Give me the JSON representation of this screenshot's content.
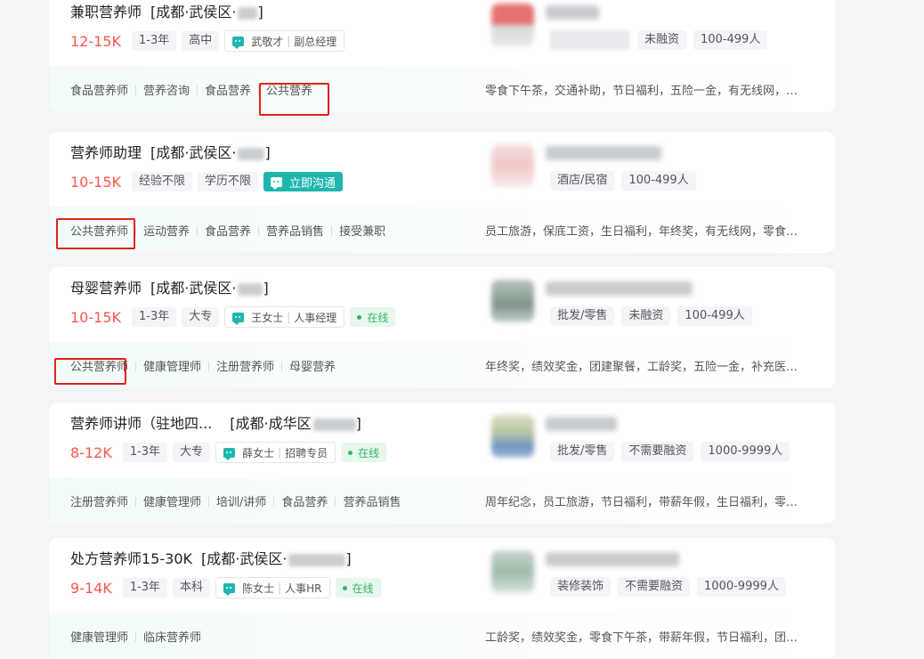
{
  "jobs": [
    {
      "title": "兼职营养师",
      "location": "[成都·武侯区·",
      "location_end": "]",
      "salary": "12-15K",
      "tags": [
        "1-3年",
        "高中"
      ],
      "recruiter": {
        "name": "武敬才",
        "role": "副总经理"
      },
      "skills": [
        "食品营养师",
        "营养咨询",
        "食品营养",
        "公共营养"
      ],
      "welfare": "零食下午茶，交通补助，节日福利，五险一金，有无线网，…",
      "company_tags": [
        "未融资",
        "100-499人"
      ],
      "logo_color": "#e57373"
    },
    {
      "title": "营养师助理",
      "location": "[成都·武侯区·",
      "location_end": "]",
      "salary": "10-15K",
      "tags": [
        "经验不限",
        "学历不限"
      ],
      "chat_button": "立即沟通",
      "skills": [
        "公共营养师",
        "运动营养",
        "食品营养",
        "营养品销售",
        "接受兼职"
      ],
      "welfare": "员工旅游，保底工资，生日福利，年终奖，有无线网，零食…",
      "company_tags": [
        "酒店/民宿",
        "100-499人"
      ],
      "logo_color": "#f4c4c4"
    },
    {
      "title": "母婴营养师",
      "location": "[成都·武侯区·",
      "location_end": "]",
      "salary": "10-15K",
      "tags": [
        "1-3年",
        "大专"
      ],
      "recruiter": {
        "name": "王女士",
        "role": "人事经理"
      },
      "online": "在线",
      "skills": [
        "公共营养师",
        "健康管理师",
        "注册营养师",
        "母婴营养"
      ],
      "welfare": "年终奖，绩效奖金，团建聚餐，工龄奖，五险一金，补充医…",
      "company_tags": [
        "批发/零售",
        "未融资",
        "100-499人"
      ],
      "logo_color": "#8fa59a"
    },
    {
      "title": "营养师讲师（驻地四...",
      "location": "[成都·成华区",
      "location_end": "]",
      "salary": "8-12K",
      "tags": [
        "1-3年",
        "大专"
      ],
      "recruiter": {
        "name": "薛女士",
        "role": "招聘专员"
      },
      "online": "在线",
      "skills": [
        "注册营养师",
        "健康管理师",
        "培训/讲师",
        "食品营养",
        "营养品销售"
      ],
      "welfare": "周年纪念，员工旅游，节日福利，带薪年假，生日福利，零…",
      "company_tags": [
        "批发/零售",
        "不需要融资",
        "1000-9999人"
      ],
      "logo_color": "#9fb7c9"
    },
    {
      "title": "处方营养师15-30K",
      "location": "[成都·武侯区·",
      "location_end": "]",
      "salary": "9-14K",
      "tags": [
        "1-3年",
        "本科"
      ],
      "recruiter": {
        "name": "陈女士",
        "role": "人事HR"
      },
      "online": "在线",
      "skills": [
        "健康管理师",
        "临床营养师"
      ],
      "welfare": "工龄奖，绩效奖金，零食下午茶，带薪年假，节日福利，团…",
      "company_tags": [
        "装修装饰",
        "不需要融资",
        "1000-9999人"
      ],
      "logo_color": "#a9c4b3"
    }
  ]
}
